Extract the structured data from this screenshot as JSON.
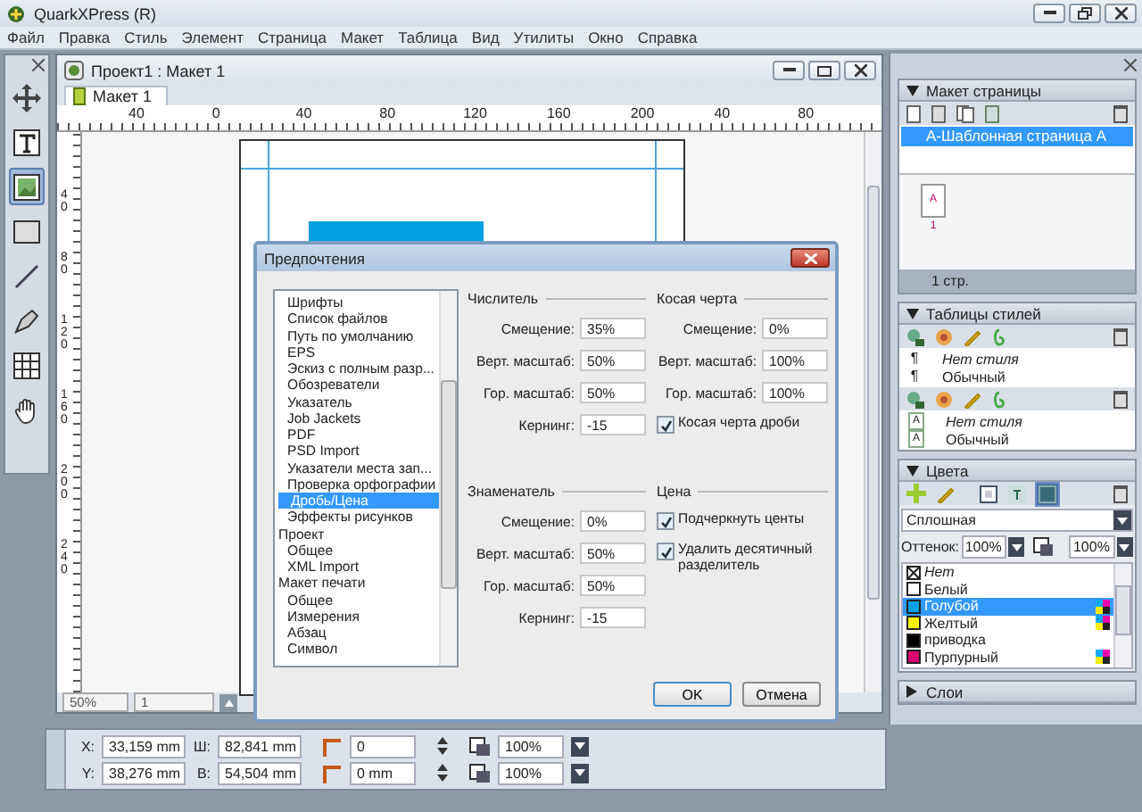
{
  "app": {
    "title": "QuarkXPress (R)"
  },
  "menu": [
    "Файл",
    "Правка",
    "Стиль",
    "Элемент",
    "Страница",
    "Макет",
    "Таблица",
    "Вид",
    "Утилиты",
    "Окно",
    "Справка"
  ],
  "toolbox": [
    {
      "kind": "move",
      "selected": false
    },
    {
      "kind": "text",
      "selected": false
    },
    {
      "kind": "picture",
      "selected": true
    },
    {
      "kind": "rectangle",
      "selected": false
    },
    {
      "kind": "line",
      "selected": false
    },
    {
      "kind": "pen",
      "selected": false
    },
    {
      "kind": "table",
      "selected": false
    },
    {
      "kind": "hand",
      "selected": false
    }
  ],
  "document": {
    "title": "Проект1 : Макет 1",
    "tabs": [
      {
        "label": "Макет 1",
        "selected": true
      }
    ],
    "ruler_h": [
      "40",
      "0",
      "40",
      "80",
      "120",
      "160",
      "200",
      "40",
      "80"
    ],
    "ruler_v": [
      "40",
      "80",
      "120",
      "160",
      "200",
      "240"
    ],
    "zoom": "50%",
    "page": "1"
  },
  "palettes": {
    "page_layout": {
      "title": "Макет страницы",
      "expanded": true,
      "masters": [
        {
          "label": "А-Шаблонная страница А",
          "selected": true
        }
      ],
      "pages": [
        {
          "master": "A",
          "number": "1"
        }
      ],
      "count": "1 стр."
    },
    "style_sheets": {
      "title": "Таблицы стилей",
      "expanded": true,
      "paragraph": [
        {
          "marker": "¶",
          "label": "Нет стиля",
          "kind": "none"
        },
        {
          "marker": "¶",
          "label": "Обычный",
          "kind": "style"
        }
      ],
      "character": [
        {
          "marker": "A",
          "label": "Нет стиля",
          "kind": "none"
        },
        {
          "marker": "A",
          "label": "Обычный",
          "kind": "style"
        }
      ]
    },
    "colors": {
      "title": "Цвета",
      "expanded": true,
      "fill_type": "Сплошная",
      "shade_label": "Оттенок:",
      "shade": "100%",
      "opacity": "100%",
      "items": [
        {
          "label": "Нет",
          "kind": "none",
          "selected": false,
          "process": false
        },
        {
          "label": "Белый",
          "kind": "swatch",
          "color": "#ffffff",
          "selected": false,
          "process": false
        },
        {
          "label": "Голубой",
          "kind": "swatch",
          "color": "#00a0e3",
          "selected": true,
          "process": true
        },
        {
          "label": "Желтый",
          "kind": "swatch",
          "color": "#fff200",
          "selected": false,
          "process": true
        },
        {
          "label": "приводка",
          "kind": "swatch",
          "color": "#000000",
          "selected": false,
          "process": false
        },
        {
          "label": "Пурпурный",
          "kind": "swatch",
          "color": "#d6006f",
          "selected": false,
          "process": true
        }
      ]
    },
    "layers": {
      "title": "Слои",
      "expanded": false
    }
  },
  "measurements": {
    "rows": [
      {
        "fields": [
          {
            "kind": "label",
            "label": "X:",
            "value": "33,159 mm"
          },
          {
            "kind": "label",
            "label": "Ш:",
            "value": "82,841 mm"
          },
          {
            "kind": "spin",
            "value": "0"
          },
          {
            "kind": "drop",
            "value": "100%"
          }
        ]
      },
      {
        "fields": [
          {
            "kind": "label",
            "label": "Y:",
            "value": "38,276 mm"
          },
          {
            "kind": "label",
            "label": "В:",
            "value": "54,504 mm"
          },
          {
            "kind": "spin",
            "value": "0 mm"
          },
          {
            "kind": "drop",
            "value": "100%"
          }
        ]
      }
    ]
  },
  "dialog": {
    "title": "Предпочтения",
    "tree": [
      {
        "children": [
          {
            "label": "Шрифты",
            "selected": false
          },
          {
            "label": "Список файлов",
            "selected": false
          },
          {
            "label": "Путь по умолчанию",
            "selected": false
          },
          {
            "label": "EPS",
            "selected": false
          },
          {
            "label": "Эскиз с полным разр...",
            "selected": false
          },
          {
            "label": "Обозреватели",
            "selected": false
          },
          {
            "label": "Указатель",
            "selected": false
          },
          {
            "label": "Job Jackets",
            "selected": false
          },
          {
            "label": "PDF",
            "selected": false
          },
          {
            "label": "PSD Import",
            "selected": false
          },
          {
            "label": "Указатели места зап...",
            "selected": false
          },
          {
            "label": "Проверка орфографии",
            "selected": false
          },
          {
            "label": "Дробь/Цена",
            "selected": true
          },
          {
            "label": "Эффекты рисунков",
            "selected": false
          }
        ]
      },
      {
        "label": "Проект",
        "selected": false,
        "children": [
          {
            "label": "Общее",
            "selected": false
          },
          {
            "label": "XML Import",
            "selected": false
          }
        ]
      },
      {
        "label": "Макет печати",
        "selected": false,
        "children": [
          {
            "label": "Общее",
            "selected": false
          },
          {
            "label": "Измерения",
            "selected": false
          },
          {
            "label": "Абзац",
            "selected": false
          },
          {
            "label": "Символ",
            "selected": false
          }
        ]
      }
    ],
    "groups": [
      {
        "title": "Числитель",
        "fields": [
          {
            "label": "Смещение:",
            "value": "35%"
          },
          {
            "label": "Верт. масштаб:",
            "value": "50%"
          },
          {
            "label": "Гор. масштаб:",
            "value": "50%"
          },
          {
            "label": "Кернинг:",
            "value": "-15"
          }
        ]
      },
      {
        "title": "Косая черта",
        "fields": [
          {
            "label": "Смещение:",
            "value": "0%"
          },
          {
            "label": "Верт. масштаб:",
            "value": "100%"
          },
          {
            "label": "Гор. масштаб:",
            "value": "100%"
          }
        ],
        "checks": [
          {
            "label": "Косая черта дроби",
            "checked": true
          }
        ]
      },
      {
        "title": "Знаменатель",
        "fields": [
          {
            "label": "Смещение:",
            "value": "0%"
          },
          {
            "label": "Верт. масштаб:",
            "value": "50%"
          },
          {
            "label": "Гор. масштаб:",
            "value": "50%"
          },
          {
            "label": "Кернинг:",
            "value": "-15"
          }
        ]
      },
      {
        "title": "Цена",
        "checks": [
          {
            "label": "Подчеркнуть центы",
            "checked": true
          },
          {
            "label": "Удалить десятичный разделитель",
            "checked": true
          }
        ]
      }
    ],
    "buttons": [
      {
        "label": "OK",
        "default": true
      },
      {
        "label": "Отмена",
        "default": false
      }
    ]
  }
}
